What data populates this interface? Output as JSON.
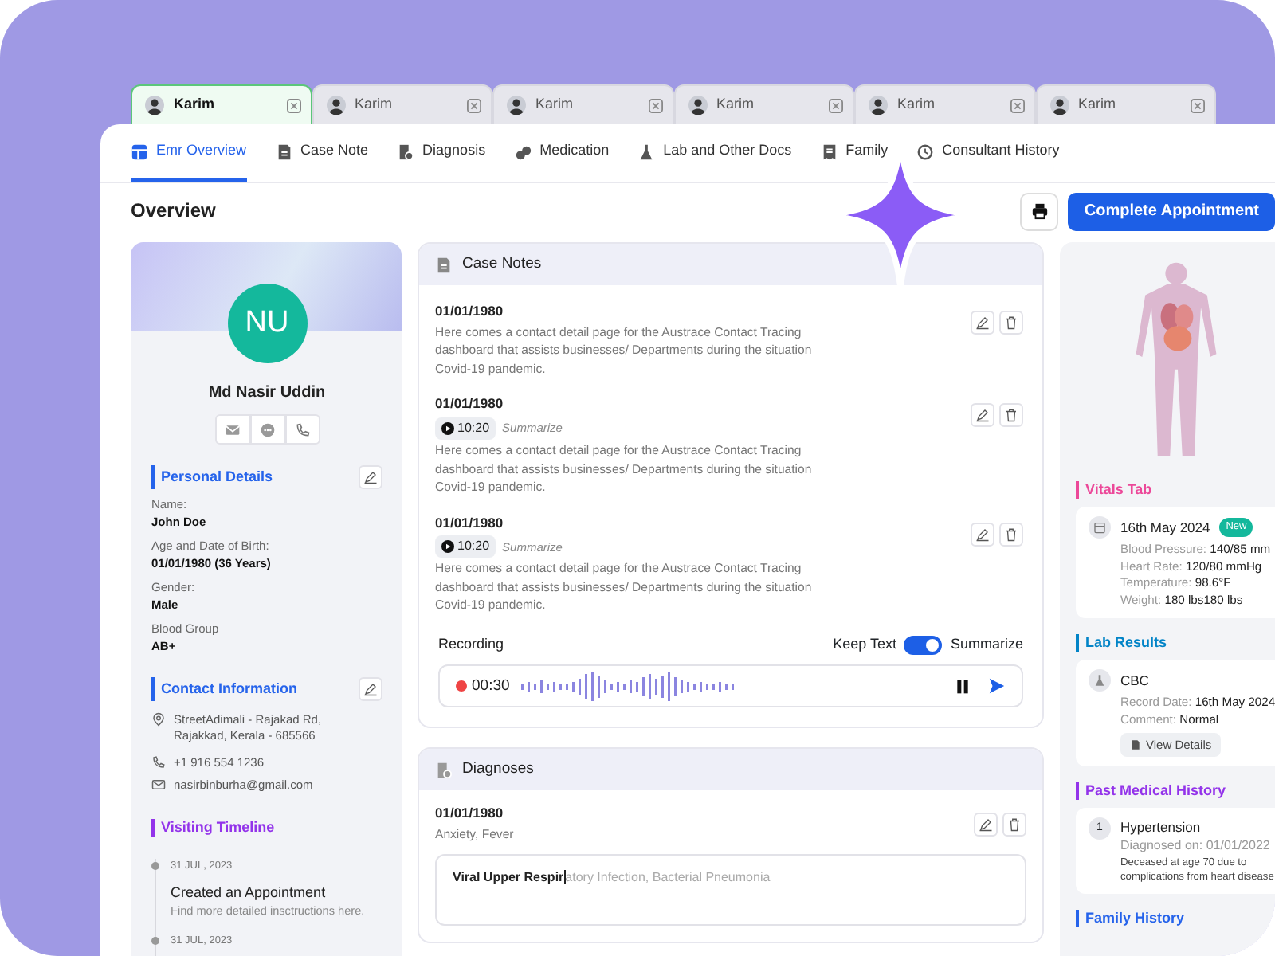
{
  "tabs": [
    {
      "label": "Karim",
      "selected": true
    },
    {
      "label": "Karim",
      "selected": false
    },
    {
      "label": "Karim",
      "selected": false
    },
    {
      "label": "Karim",
      "selected": false
    },
    {
      "label": "Karim",
      "selected": false
    },
    {
      "label": "Karim",
      "selected": false
    }
  ],
  "nav": [
    {
      "label": "Emr Overview",
      "selected": true
    },
    {
      "label": "Case Note",
      "selected": false
    },
    {
      "label": "Diagnosis",
      "selected": false
    },
    {
      "label": "Medication",
      "selected": false
    },
    {
      "label": "Lab and Other Docs",
      "selected": false
    },
    {
      "label": "Family",
      "selected": false
    },
    {
      "label": "Consultant History",
      "selected": false
    }
  ],
  "page_title": "Overview",
  "complete_button": "Complete Appointment",
  "profile": {
    "initials": "NU",
    "name": "Md Nasir Uddin"
  },
  "personal_details": {
    "title": "Personal Details",
    "color": "#2563eb",
    "fields": [
      {
        "label": "Name:",
        "value": "John Doe"
      },
      {
        "label": "Age and Date of Birth:",
        "value": "01/01/1980 (36 Years)"
      },
      {
        "label": "Gender:",
        "value": "Male"
      },
      {
        "label": "Blood Group",
        "value": "AB+"
      }
    ]
  },
  "contact": {
    "title": "Contact Information",
    "color": "#2563eb",
    "address": "StreetAdimali - Rajakad Rd, Rajakkad, Kerala - 685566",
    "phone": "+1 916 554 1236",
    "email": "nasirbinburha@gmail.com"
  },
  "timeline": {
    "title": "Visiting Timeline",
    "color": "#9333ea",
    "events": [
      {
        "date": "31 JUL, 2023",
        "title": "Created an Appointment",
        "detail": "Find more detailed insctructions here."
      },
      {
        "date": "31 JUL, 2023"
      }
    ]
  },
  "case_notes": {
    "title": "Case Notes",
    "notes": [
      {
        "date": "01/01/1980",
        "text": "Here comes a contact detail page for the Austrace Contact Tracing dashboard that assists businesses/ Departments during the situation Covid-19 pandemic."
      },
      {
        "date": "01/01/1980",
        "audio_time": "10:20",
        "audio_label": "Summarize",
        "text": "Here comes a contact detail page for the Austrace Contact Tracing dashboard that assists businesses/ Departments during the situation Covid-19 pandemic."
      },
      {
        "date": "01/01/1980",
        "audio_time": "10:20",
        "audio_label": "Summarize",
        "text": "Here comes a contact detail page for the Austrace Contact Tracing dashboard that assists businesses/ Departments during the situation Covid-19 pandemic."
      }
    ]
  },
  "recording": {
    "label": "Recording",
    "keep_text": "Keep Text",
    "summarize": "Summarize",
    "summarize_on": true,
    "time": "00:30"
  },
  "diagnoses": {
    "title": "Diagnoses",
    "entries": [
      {
        "date": "01/01/1980",
        "text": "Anxiety, Fever",
        "input_value": "Viral Upper Respir",
        "suggestion": "atory Infection,  Bacterial Pneumonia"
      }
    ]
  },
  "vitals": {
    "title": "Vitals Tab",
    "color": "#ec4899",
    "date": "16th May 2024",
    "badge": "New",
    "rows": [
      {
        "label": "Blood Pressure:",
        "value": "140/85 mm"
      },
      {
        "label": "Heart Rate:",
        "value": "120/80 mmHg"
      },
      {
        "label": "Temperature:",
        "value": "98.6°F"
      },
      {
        "label": "Weight:",
        "value": "180 lbs180 lbs"
      }
    ]
  },
  "lab_results": {
    "title": "Lab Results",
    "color": "#0284c7",
    "name": "CBC",
    "rows": [
      {
        "label": "Record Date:",
        "value": "16th May 2024"
      },
      {
        "label": "Comment:",
        "value": "Normal"
      }
    ],
    "button": "View Details"
  },
  "past_history": {
    "title": "Past Medical History",
    "color": "#9333ea",
    "items": [
      {
        "number": "1",
        "name": "Hypertension",
        "date": "Diagnosed on: 01/01/2022",
        "note": "Deceased at age 70 due to complications from heart disease"
      }
    ]
  },
  "family_history": {
    "title": "Family History",
    "color": "#2563eb"
  }
}
